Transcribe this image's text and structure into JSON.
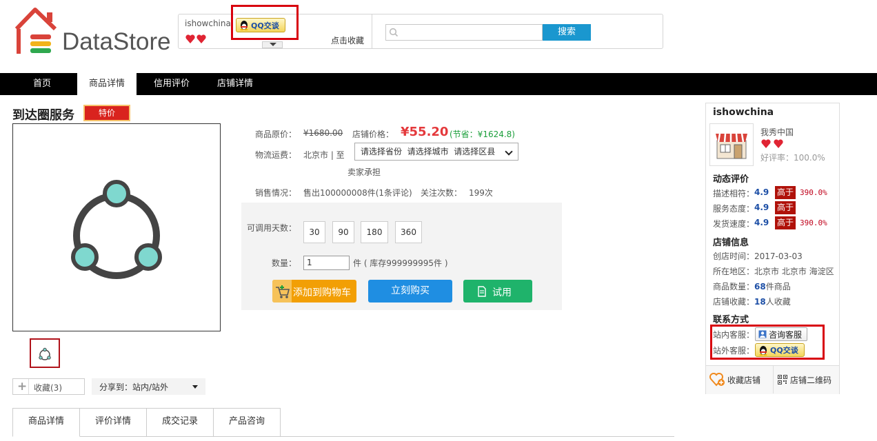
{
  "header": {
    "logo_text": "DataStore",
    "shop_name": "ishowchina",
    "qq_button": "QQ交谈",
    "bookmark": "点击收藏",
    "search_button": "搜索",
    "search_placeholder": ""
  },
  "nav": {
    "items": [
      {
        "label": "首页"
      },
      {
        "label": "商品详情"
      },
      {
        "label": "信用评价"
      },
      {
        "label": "店铺详情"
      }
    ],
    "active_index": 1
  },
  "product": {
    "title": "到达圈服务",
    "badge": "特价",
    "original_price_label": "商品原价：",
    "original_price": "¥1680.00",
    "store_price_label": "店铺价格：",
    "store_price": "¥55.20",
    "save": "(节省：¥1624.8)",
    "shipping_label": "物流运费：",
    "shipping_from": "北京市 | 至",
    "region_select": "请选择省份  请选择城市  请选择区县",
    "shipping_note": "卖家承担",
    "sales_label": "销售情况：",
    "sales_value": "售出100000008件(1条评论)",
    "follow_label": "关注次数：",
    "follow_value": "199次",
    "days_label": "可调用天数：",
    "days": [
      "30",
      "90",
      "180",
      "360"
    ],
    "qty_label": "数量：",
    "qty_value": "1",
    "stock": "件 ( 库存999999995件 )",
    "add_cart": "添加到购物车",
    "buy_now": "立刻购买",
    "trial": "试用",
    "favorite": "收藏(3)",
    "share": "分享到：站内/站外"
  },
  "tabs": [
    "商品详情",
    "评价详情",
    "成交记录",
    "产品咨询"
  ],
  "sidebar": {
    "shop_name": "ishowchina",
    "shop_sub": "我秀中国",
    "good_rate": "好评率：100.0%",
    "rating_heading": "动态评价",
    "ratings": [
      {
        "label": "描述相符：",
        "score": "4.9",
        "badge": "高于",
        "pct": "390.0%"
      },
      {
        "label": "服务态度：",
        "score": "4.9",
        "badge": "高于",
        "pct": ""
      },
      {
        "label": "发货速度：",
        "score": "4.9",
        "badge": "高于",
        "pct": "390.0%"
      }
    ],
    "info_heading": "店铺信息",
    "open_time": "创店时间：2017-03-03",
    "region": "所在地区：北京市 北京市 海淀区",
    "goods_count_label": "商品数量：",
    "goods_count": "68",
    "goods_count_suffix": "件商品",
    "fav_count_label": "店铺收藏：",
    "fav_count": "18",
    "fav_count_suffix": "人收藏",
    "contact_heading": "联系方式",
    "inner_cs_label": "站内客服：",
    "inner_cs_button": "咨询客服",
    "outer_cs_label": "站外客服：",
    "outer_cs_button": "QQ交谈",
    "fav_shop": "收藏店铺",
    "qr_code": "店铺二维码"
  },
  "colors": {
    "accent_red": "#e4393c",
    "nav_bg": "#000000",
    "search_blue": "#1a97cf",
    "cart_orange": "#f29f05",
    "buy_blue": "#1f8ee2",
    "trial_green": "#1fb36b",
    "highlight_box": "#d8000d"
  }
}
